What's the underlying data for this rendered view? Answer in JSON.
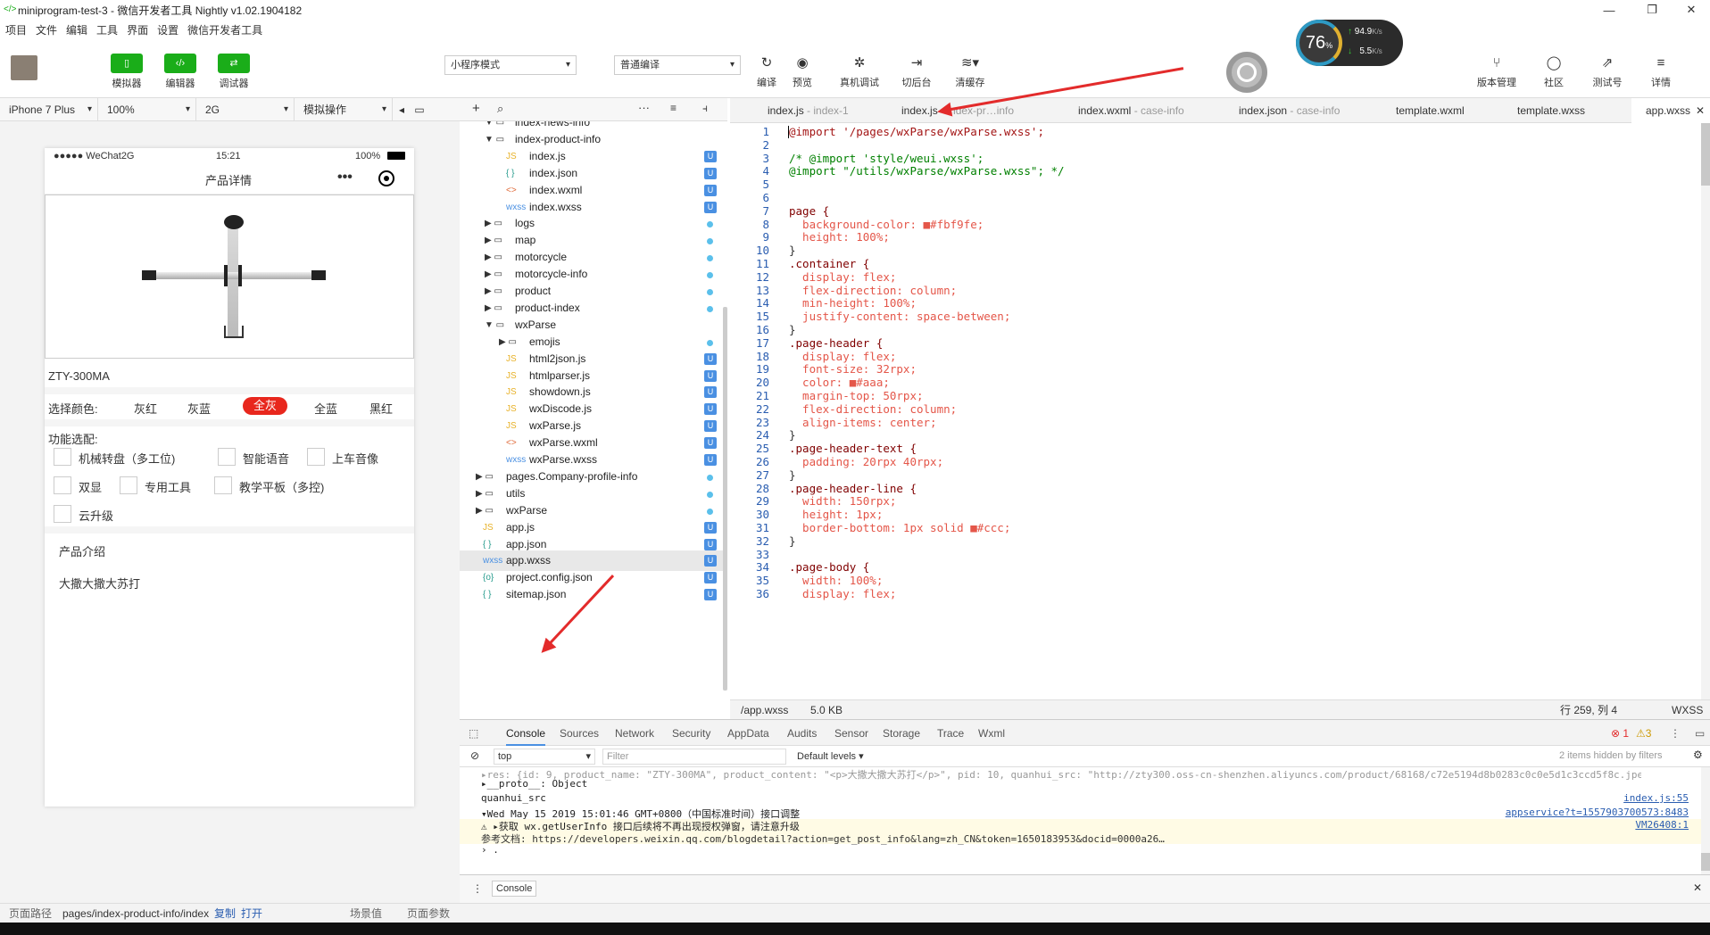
{
  "window": {
    "title": "miniprogram-test-3 - 微信开发者工具 Nightly v1.02.1904182",
    "controls": [
      "—",
      "❐",
      "✕"
    ]
  },
  "menu": [
    "项目",
    "文件",
    "编辑",
    "工具",
    "界面",
    "设置",
    "微信开发者工具"
  ],
  "toolbar": {
    "green_buttons": [
      {
        "label": "模拟器",
        "icon": "phone-icon"
      },
      {
        "label": "编辑器",
        "icon": "code-icon"
      },
      {
        "label": "调试器",
        "icon": "debug-icon"
      }
    ],
    "mode_select": "小程序模式",
    "compile_select": "普通编译",
    "actions": [
      {
        "label": "编译",
        "icon": "refresh-icon"
      },
      {
        "label": "预览",
        "icon": "eye-icon"
      },
      {
        "label": "真机调试",
        "icon": "bug-icon"
      },
      {
        "label": "切后台",
        "icon": "switch-icon"
      },
      {
        "label": "清缓存",
        "icon": "stack-icon"
      }
    ],
    "right_actions": [
      {
        "label": "版本管理",
        "icon": "branch-icon"
      },
      {
        "label": "社区",
        "icon": "chat-icon"
      },
      {
        "label": "测试号",
        "icon": "external-icon"
      },
      {
        "label": "详情",
        "icon": "menu-icon"
      }
    ],
    "perf": {
      "percent": "76",
      "percent_unit": "%",
      "up": "94.9",
      "down": "5.5",
      "unit": "K/s"
    }
  },
  "devbar": {
    "device": "iPhone 7 Plus",
    "zoom": "100%",
    "network": "2G",
    "sim_op": "模拟操作"
  },
  "phone": {
    "carrier": "●●●●● WeChat2G",
    "time": "15:21",
    "battery": "100%",
    "title": "产品详情",
    "menu_dots": "•••",
    "product_name": "ZTY-300MA",
    "color_label": "选择颜色:",
    "colors": [
      "灰红",
      "灰蓝",
      "全灰",
      "全蓝",
      "黑红"
    ],
    "active_color_index": 2,
    "feature_label": "功能选配:",
    "features": [
      "机械转盘（多工位)",
      "智能语音",
      "上车音像",
      "双显",
      "专用工具",
      "教学平板（多控)",
      "云升级"
    ],
    "intro_title": "产品介绍",
    "intro_text": "大撒大撒大苏打"
  },
  "tree": {
    "items": [
      {
        "name": "index-news-info",
        "depth": 1,
        "type": "folder-open",
        "mark": ""
      },
      {
        "name": "index-product-info",
        "depth": 1,
        "type": "folder-open",
        "mark": ""
      },
      {
        "name": "index.js",
        "depth": 2,
        "type": "js",
        "mark": "U"
      },
      {
        "name": "index.json",
        "depth": 2,
        "type": "json",
        "mark": "U"
      },
      {
        "name": "index.wxml",
        "depth": 2,
        "type": "wxml",
        "mark": "U"
      },
      {
        "name": "index.wxss",
        "depth": 2,
        "type": "wxss",
        "mark": "U"
      },
      {
        "name": "logs",
        "depth": 1,
        "type": "folder",
        "mark": "dot"
      },
      {
        "name": "map",
        "depth": 1,
        "type": "folder",
        "mark": "dot"
      },
      {
        "name": "motorcycle",
        "depth": 1,
        "type": "folder",
        "mark": "dot"
      },
      {
        "name": "motorcycle-info",
        "depth": 1,
        "type": "folder",
        "mark": "dot"
      },
      {
        "name": "product",
        "depth": 1,
        "type": "folder",
        "mark": "dot"
      },
      {
        "name": "product-index",
        "depth": 1,
        "type": "folder",
        "mark": "dot"
      },
      {
        "name": "wxParse",
        "depth": 1,
        "type": "folder-open",
        "mark": ""
      },
      {
        "name": "emojis",
        "depth": 2,
        "type": "folder",
        "mark": "dot"
      },
      {
        "name": "html2json.js",
        "depth": 2,
        "type": "js",
        "mark": "U"
      },
      {
        "name": "htmlparser.js",
        "depth": 2,
        "type": "js",
        "mark": "U"
      },
      {
        "name": "showdown.js",
        "depth": 2,
        "type": "js",
        "mark": "U"
      },
      {
        "name": "wxDiscode.js",
        "depth": 2,
        "type": "js",
        "mark": "U"
      },
      {
        "name": "wxParse.js",
        "depth": 2,
        "type": "js",
        "mark": "U"
      },
      {
        "name": "wxParse.wxml",
        "depth": 2,
        "type": "wxml",
        "mark": "U"
      },
      {
        "name": "wxParse.wxss",
        "depth": 2,
        "type": "wxss",
        "mark": "U"
      },
      {
        "name": "pages.Company-profile-info",
        "depth": 0,
        "type": "folder",
        "mark": "dot"
      },
      {
        "name": "utils",
        "depth": 0,
        "type": "folder",
        "mark": "dot"
      },
      {
        "name": "wxParse",
        "depth": 0,
        "type": "folder",
        "mark": "dot"
      },
      {
        "name": "app.js",
        "depth": 0,
        "type": "js",
        "mark": "U"
      },
      {
        "name": "app.json",
        "depth": 0,
        "type": "json",
        "mark": "U"
      },
      {
        "name": "app.wxss",
        "depth": 0,
        "type": "wxss",
        "mark": "U",
        "selected": true
      },
      {
        "name": "project.config.json",
        "depth": 0,
        "type": "config",
        "mark": "U"
      },
      {
        "name": "sitemap.json",
        "depth": 0,
        "type": "json",
        "mark": "U"
      }
    ]
  },
  "tabs": [
    {
      "name": "index.js",
      "meta": " - index-1"
    },
    {
      "name": "index.js",
      "meta": " - index-pr…info"
    },
    {
      "name": "index.wxml",
      "meta": " - case-info"
    },
    {
      "name": "index.json",
      "meta": " - case-info"
    },
    {
      "name": "template.wxml",
      "meta": ""
    },
    {
      "name": "template.wxss",
      "meta": ""
    },
    {
      "name": "app.wxss",
      "meta": "",
      "active": true
    }
  ],
  "code": [
    "@import '/pages/wxParse/wxParse.wxss';",
    "",
    "/* @import 'style/weui.wxss';",
    "@import \"/utils/wxParse/wxParse.wxss\"; */",
    "",
    "",
    "page {",
    "  background-color: ■#fbf9fe;",
    "  height: 100%;",
    "}",
    ".container {",
    "  display: flex;",
    "  flex-direction: column;",
    "  min-height: 100%;",
    "  justify-content: space-between;",
    "}",
    ".page-header {",
    "  display: flex;",
    "  font-size: 32rpx;",
    "  color: ■#aaa;",
    "  margin-top: 50rpx;",
    "  flex-direction: column;",
    "  align-items: center;",
    "}",
    ".page-header-text {",
    "  padding: 20rpx 40rpx;",
    "}",
    ".page-header-line {",
    "  width: 150rpx;",
    "  height: 1px;",
    "  border-bottom: 1px solid ■#ccc;",
    "}",
    "",
    ".page-body {",
    "  width: 100%;",
    "  display: flex;"
  ],
  "status": {
    "path": "/app.wxss",
    "size": "5.0 KB",
    "pos": "行 259, 列 4",
    "lang": "WXSS"
  },
  "console": {
    "tabs": [
      "Console",
      "Sources",
      "Network",
      "Security",
      "AppData",
      "Audits",
      "Sensor",
      "Storage",
      "Trace",
      "Wxml"
    ],
    "errors": "1",
    "warnings": "3",
    "context": "top",
    "filter_placeholder": "Filter",
    "levels": "Default levels ▾",
    "hidden": "2 items hidden by filters",
    "lines": [
      {
        "text": "▸res: {id: 9, product_name: \"ZTY-300MA\", product_content: \"<p>大撒大撒大苏打</p>\", pid: 10, quanhui_src: \"http://zty300.oss-cn-shenzhen.aliyuncs.com/product/68168/c72e5194d8b0283c0c0e5d1c3ccd5f8c.jpeg\", …}",
        "src": ""
      },
      {
        "text": "  ▸__proto__: Object",
        "src": ""
      },
      {
        "text": "quanhui_src",
        "src": "index.js:55"
      },
      {
        "text": "▾Wed May 15 2019 15:01:46 GMT+0800（中国标准时间）接口调整",
        "src": "appservice?t=1557903700573:8483"
      },
      {
        "text": "⚠ ▸获取 wx.getUserInfo 接口后续将不再出现授权弹窗，请注意升级",
        "src": "VM26408:1"
      },
      {
        "text": "   参考文档: https://developers.weixin.qq.com/blogdetail?action=get_post_info&lang=zh_CN&token=1650183953&docid=0000a26…",
        "src": ""
      },
      {
        "text": "› .",
        "src": ""
      }
    ],
    "bottom_tab": "Console"
  },
  "footer": {
    "label": "页面路径",
    "path": "pages/index-product-info/index",
    "copy": "复制",
    "open": "打开",
    "scene": "场景值",
    "params": "页面参数"
  }
}
